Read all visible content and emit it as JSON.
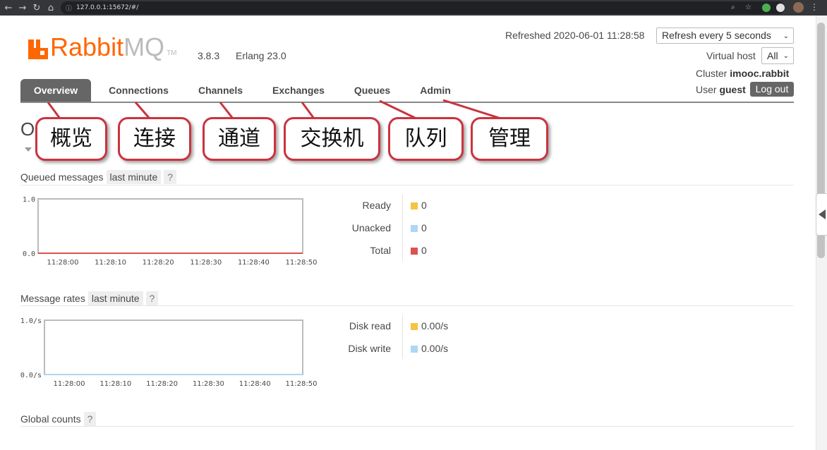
{
  "browser": {
    "url": "127.0.0.1:15672/#/",
    "icons": [
      "back-arrow-icon",
      "forward-arrow-icon",
      "reload-icon",
      "home-icon",
      "info-icon",
      "zoom-icon",
      "star-icon",
      "extension-icon",
      "avatar",
      "menu-icon"
    ]
  },
  "header": {
    "logo_rabbit": "Rabbit",
    "logo_mq": "MQ",
    "logo_tm": "TM",
    "version": "3.8.3",
    "erlang": "Erlang 23.0",
    "refreshed": "Refreshed 2020-06-01 11:28:58",
    "refresh_select": "Refresh every 5 seconds",
    "vhost_label": "Virtual host",
    "vhost_select": "All",
    "cluster_label": "Cluster",
    "cluster_name": "imooc.rabbit",
    "user_label": "User",
    "user_name": "guest",
    "logout": "Log out"
  },
  "tabs": [
    {
      "label": "Overview",
      "active": true
    },
    {
      "label": "Connections"
    },
    {
      "label": "Channels"
    },
    {
      "label": "Exchanges"
    },
    {
      "label": "Queues"
    },
    {
      "label": "Admin"
    }
  ],
  "page_title": "O",
  "callouts": [
    "概览",
    "连接",
    "通道",
    "交换机",
    "队列",
    "管理"
  ],
  "colors": {
    "accent": "#ff6600",
    "callout_border": "#c9343e",
    "ready": "#f4c542",
    "unacked": "#aed7f4",
    "total": "#d9534f",
    "tab_active": "#666666"
  },
  "queued": {
    "title": "Queued messages",
    "range": "last minute",
    "help": "?",
    "y_ticks": [
      "1.0",
      "0.0"
    ],
    "x_ticks": [
      "11:28:00",
      "11:28:10",
      "11:28:20",
      "11:28:30",
      "11:28:40",
      "11:28:50"
    ],
    "legend": [
      {
        "label": "Ready",
        "value": "0"
      },
      {
        "label": "Unacked",
        "value": "0"
      },
      {
        "label": "Total",
        "value": "0"
      }
    ]
  },
  "rates": {
    "title": "Message rates",
    "range": "last minute",
    "help": "?",
    "y_ticks": [
      "1.0/s",
      "0.0/s"
    ],
    "x_ticks": [
      "11:28:00",
      "11:28:10",
      "11:28:20",
      "11:28:30",
      "11:28:40",
      "11:28:50"
    ],
    "legend": [
      {
        "label": "Disk read",
        "value": "0.00/s"
      },
      {
        "label": "Disk write",
        "value": "0.00/s"
      }
    ]
  },
  "global": {
    "title": "Global counts",
    "help": "?"
  },
  "chart_data": [
    {
      "type": "line",
      "title": "Queued messages",
      "x": [
        "11:28:00",
        "11:28:10",
        "11:28:20",
        "11:28:30",
        "11:28:40",
        "11:28:50"
      ],
      "ylim": [
        0,
        1.0
      ],
      "series": [
        {
          "name": "Ready",
          "values": [
            0,
            0,
            0,
            0,
            0,
            0
          ]
        },
        {
          "name": "Unacked",
          "values": [
            0,
            0,
            0,
            0,
            0,
            0
          ]
        },
        {
          "name": "Total",
          "values": [
            0,
            0,
            0,
            0,
            0,
            0
          ]
        }
      ]
    },
    {
      "type": "line",
      "title": "Message rates",
      "x": [
        "11:28:00",
        "11:28:10",
        "11:28:20",
        "11:28:30",
        "11:28:40",
        "11:28:50"
      ],
      "ylim": [
        0,
        1.0
      ],
      "series": [
        {
          "name": "Disk read",
          "values": [
            0,
            0,
            0,
            0,
            0,
            0
          ]
        },
        {
          "name": "Disk write",
          "values": [
            0,
            0,
            0,
            0,
            0,
            0
          ]
        }
      ]
    }
  ]
}
